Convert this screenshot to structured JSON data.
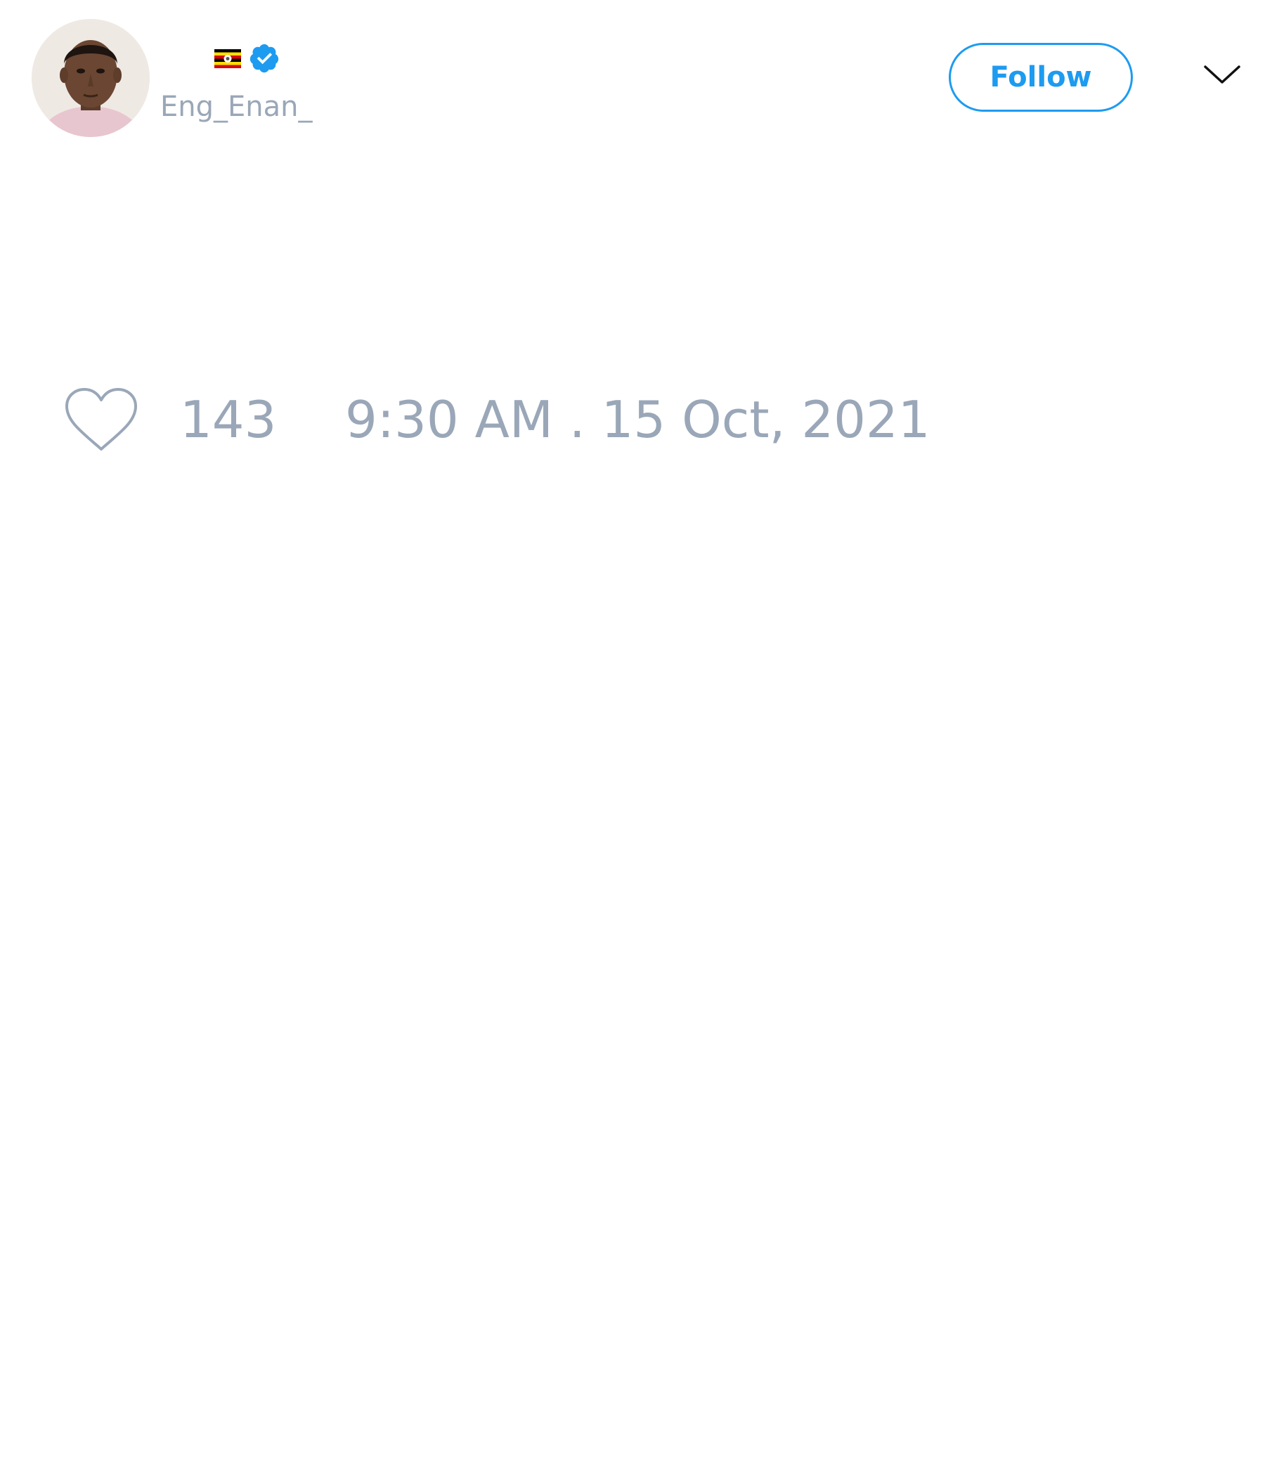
{
  "tweet": {
    "author": {
      "avatar_icon": "profile-photo",
      "flag_icon": "uganda-flag-icon",
      "verified_icon": "verified-badge-icon",
      "handle": "Eng_Enan_"
    },
    "follow_label": "Follow",
    "menu_icon": "chevron-down-icon",
    "like_icon": "heart-icon",
    "like_count": "143",
    "timestamp": "9:30 AM . 15 Oct, 2021"
  },
  "colors": {
    "accent": "#1d9bf0",
    "muted_text": "#9aa7b8",
    "background": "#ffffff"
  }
}
